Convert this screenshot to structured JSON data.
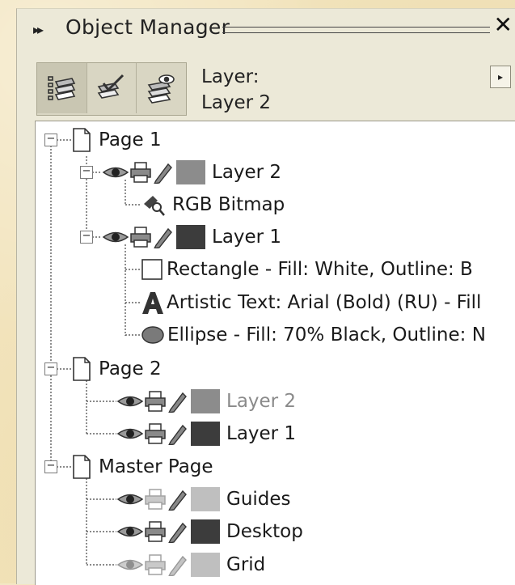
{
  "panel": {
    "title": "Object Manager",
    "close_glyph": "✕",
    "arrows_glyph": "▸▸",
    "menu_arrow_glyph": "▸"
  },
  "toolbar": {
    "layer_caption": "Layer:",
    "layer_value": "Layer 2",
    "buttons": [
      {
        "icon": "show-object-properties-icon"
      },
      {
        "icon": "edit-across-layers-icon"
      },
      {
        "icon": "layer-manager-view-icon"
      }
    ]
  },
  "tree": {
    "pages": [
      {
        "label": "Page 1"
      },
      {
        "label": "Page 2"
      },
      {
        "label": "Master Page"
      }
    ],
    "layers": [
      {
        "label": "Layer 2",
        "color": "#8c8c8c",
        "dim": false
      },
      {
        "label": "Layer 1",
        "color": "#3c3c3c",
        "dim": false
      },
      {
        "label": "Layer 2",
        "color": "#8c8c8c",
        "dim": true
      },
      {
        "label": "Layer 1",
        "color": "#3c3c3c",
        "dim": false
      },
      {
        "label": "Guides",
        "color": "#bfbfbf",
        "dim": false
      },
      {
        "label": "Desktop",
        "color": "#3c3c3c",
        "dim": false
      },
      {
        "label": "Grid",
        "color": "#bfbfbf",
        "dim": false
      }
    ],
    "objects": [
      {
        "label": "RGB Bitmap",
        "icon": "bitmap-icon"
      },
      {
        "label": "Rectangle - Fill: White, Outline: B",
        "icon": "rectangle-icon"
      },
      {
        "label": "Artistic Text: Arial (Bold) (RU) - Fill",
        "icon": "artistic-text-icon"
      },
      {
        "label": "Ellipse - Fill: 70% Black, Outline: N",
        "icon": "ellipse-icon"
      }
    ]
  },
  "colors": {
    "panel_bg": "#ece9d8",
    "tree_bg": "#ffffff",
    "dim_text": "#8a8a8a"
  }
}
